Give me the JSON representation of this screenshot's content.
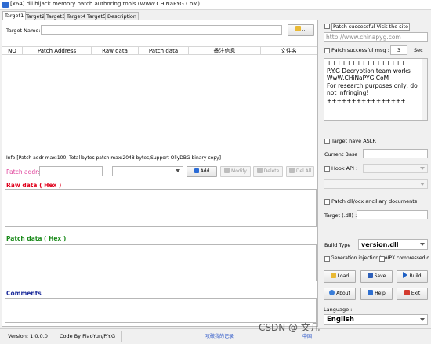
{
  "window": {
    "title": "[x64] dll hijack  memory patch authoring tools (WwW.CHiNaPYG.CoM)"
  },
  "tabs": [
    "Target1",
    "Target2",
    "Target3",
    "Target4",
    "Target5",
    "Description"
  ],
  "target": {
    "label": "Target Name:",
    "value": "",
    "browse_label": "..."
  },
  "table": {
    "headers": [
      "NO",
      "Patch Address",
      "Raw data",
      "Patch data",
      "备注信息",
      "文件名"
    ],
    "rows": []
  },
  "info_text": "Info:[Patch addr max:100, Total bytes patch max:2048 bytes,Support OllyDBG binary copy]",
  "patch_addr": {
    "label": "Patch addr:",
    "value": ""
  },
  "buttons": {
    "add": "Add",
    "modify": "Modify",
    "delete": "Delete",
    "del_all": "Del All"
  },
  "sections": {
    "raw_data": "Raw data ( Hex )",
    "patch_data": "Patch data ( Hex )",
    "comments": "Comments"
  },
  "right": {
    "patch_visit_label": "Patch successful Visit the site",
    "site_url": "http://www.chinapyg.com",
    "patch_msg_label": "Patch successful msg :",
    "msg_seconds": "3",
    "sec_label": "Sec",
    "msg_lines": [
      "++++++++++++++++",
      "P.Y.G Decryption team works",
      "WwW.CHiNaPYG.CoM",
      "For research purposes only, do",
      "not infringing!",
      "++++++++++++++++"
    ],
    "target_aslr_label": "Target have ASLR",
    "current_base_label": "Current Base :",
    "current_base_value": "",
    "hook_api_label": "Hook API :",
    "patch_dll_label": "Patch dll/ocx ancillary documents",
    "target_dll_label": "Target (.dll) :",
    "target_dll_value": "",
    "build_type_label": "Build Type :",
    "build_type_value": "version.dll",
    "gen_injection_label": "Generation injection too",
    "upx_label": "UPX compressed output",
    "buttons": {
      "load": "Load",
      "save": "Save",
      "build": "Build",
      "about": "About",
      "help": "Help",
      "exit": "Exit"
    },
    "language_label": "Language :",
    "language_value": "English"
  },
  "status": {
    "version": "Version: 1.0.0.0",
    "code_by": "Code By PiaoYun/P.Y.G",
    "forum": "攻破我的记录",
    "site": "中国",
    "watermark": "CSDN @ 文几"
  },
  "colors": {
    "raw_title": "#e0001b",
    "patch_title": "#1a8a1a",
    "comments_title": "#1f2f9c",
    "patch_addr_label": "#e0409a"
  }
}
